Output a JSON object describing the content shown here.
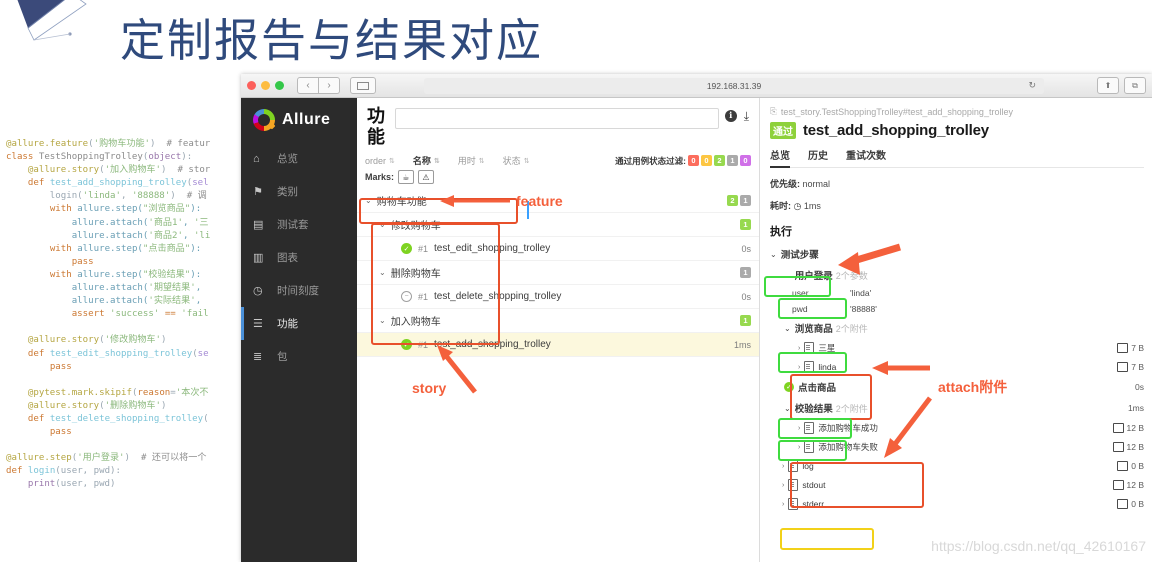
{
  "slide": {
    "title": "定制报告与结果对应",
    "watermark": "https://blog.csdn.net/qq_42610167"
  },
  "code": {
    "lines": [
      "@allure.feature('购物车功能')  # featur",
      "class TestShoppingTrolley(object):",
      "    @allure.story('加入购物车')  # stor",
      "    def test_add_shopping_trolley(sel",
      "        login('linda', '88888')  # 调",
      "        with allure.step(\"浏览商品\"):",
      "            allure.attach('商品1', '三",
      "            allure.attach('商品2', 'li",
      "        with allure.step(\"点击商品\"):",
      "            pass",
      "        with allure.step(\"校验结果\"):",
      "            allure.attach('期望结果',",
      "            allure.attach('实际结果',",
      "            assert 'success' == 'fail",
      "",
      "    @allure.story('修改购物车')",
      "    def test_edit_shopping_trolley(se",
      "        pass",
      "",
      "    @pytest.mark.skipif(reason='本次不",
      "    @allure.story('删除购物车')",
      "    def test_delete_shopping_trolley(",
      "        pass",
      "",
      "@allure.step('用户登录')  # 还可以将一个",
      "def login(user, pwd):",
      "    print(user, pwd)"
    ]
  },
  "browser": {
    "url": "192.168.31.39",
    "back_icon": "‹",
    "forward_icon": "›",
    "reload_icon": "↻",
    "share_icon": "⬆",
    "tabs_icon": "⧉"
  },
  "allure": {
    "brand": "Allure",
    "sidebar": [
      {
        "label": "总览",
        "icon": "home-icon",
        "glyph": "⌂",
        "selected": false
      },
      {
        "label": "类别",
        "icon": "flag-icon",
        "glyph": "⚑",
        "selected": false
      },
      {
        "label": "测试套",
        "icon": "briefcase-icon",
        "glyph": "▤",
        "selected": false
      },
      {
        "label": "图表",
        "icon": "chart-icon",
        "glyph": "▥",
        "selected": false
      },
      {
        "label": "时间刻度",
        "icon": "clock-icon",
        "glyph": "◷",
        "selected": false
      },
      {
        "label": "功能",
        "icon": "list-icon",
        "glyph": "☰",
        "selected": true
      },
      {
        "label": "包",
        "icon": "lines-icon",
        "glyph": "≣",
        "selected": false
      }
    ]
  },
  "main": {
    "title": "功能",
    "search_placeholder": "",
    "search_value": "",
    "columns": [
      {
        "label": "order",
        "bold": false
      },
      {
        "label": "名称",
        "bold": true
      },
      {
        "label": "用时",
        "bold": false
      },
      {
        "label": "状态",
        "bold": false
      }
    ],
    "filter_label": "通过用例状态过滤:",
    "filter_badges": [
      {
        "count": "0",
        "color": "#fc6d5d"
      },
      {
        "count": "0",
        "color": "#fdc642"
      },
      {
        "count": "2",
        "color": "#97d94f"
      },
      {
        "count": "1",
        "color": "#aaaaaa"
      },
      {
        "count": "0",
        "color": "#d070e8"
      }
    ],
    "marks_label": "Marks:",
    "marks": [
      "☕",
      "⚠"
    ],
    "tree": [
      {
        "level": 1,
        "chevron": "⌄",
        "name": "购物车功能",
        "badges": [
          {
            "count": "2",
            "color": "#97d94f"
          },
          {
            "count": "1",
            "color": "#aaaaaa"
          }
        ],
        "time": "",
        "status": "",
        "id": "",
        "selected": false,
        "highlight": "feature-box"
      },
      {
        "level": 2,
        "chevron": "⌄",
        "name": "修改购物车",
        "badges": [
          {
            "count": "1",
            "color": "#97d94f"
          }
        ],
        "time": "",
        "status": "",
        "id": "",
        "selected": false
      },
      {
        "level": 3,
        "chevron": "",
        "name": "test_edit_shopping_trolley",
        "badges": [],
        "time": "0s",
        "status": "pass",
        "id": "#1",
        "selected": false
      },
      {
        "level": 2,
        "chevron": "⌄",
        "name": "删除购物车",
        "badges": [
          {
            "count": "1",
            "color": "#aaaaaa"
          }
        ],
        "time": "",
        "status": "",
        "id": "",
        "selected": false
      },
      {
        "level": 3,
        "chevron": "",
        "name": "test_delete_shopping_trolley",
        "badges": [],
        "time": "0s",
        "status": "skip",
        "id": "#1",
        "selected": false
      },
      {
        "level": 2,
        "chevron": "⌄",
        "name": "加入购物车",
        "badges": [
          {
            "count": "1",
            "color": "#97d94f"
          }
        ],
        "time": "",
        "status": "",
        "id": "",
        "selected": false
      },
      {
        "level": 3,
        "chevron": "",
        "name": "test_add_shopping_trolley",
        "badges": [],
        "time": "1ms",
        "status": "pass",
        "id": "#1",
        "selected": true
      }
    ]
  },
  "detail": {
    "breadcrumb": "test_story.TestShoppingTrolley#test_add_shopping_trolley",
    "status_tag": "通过",
    "test_name": "test_add_shopping_trolley",
    "tabs": [
      {
        "label": "总览",
        "active": true
      },
      {
        "label": "历史",
        "active": false
      },
      {
        "label": "重试次数",
        "active": false
      }
    ],
    "severity_key": "优先级:",
    "severity_val": "normal",
    "duration_key": "耗时:",
    "duration_val": "1ms",
    "execution_header": "执行",
    "steps_label": "测试步骤",
    "nodes": [
      {
        "type": "step",
        "indent": 1,
        "chevron": "⌄",
        "name": "用户登录",
        "sub": "2个参数",
        "size": "",
        "highlight": "green"
      },
      {
        "type": "param",
        "key": "user",
        "value": "'linda'"
      },
      {
        "type": "param",
        "key": "pwd",
        "value": "'88888'"
      },
      {
        "type": "step",
        "indent": 1,
        "chevron": "⌄",
        "name": "浏览商品",
        "sub": "2个附件",
        "size": "",
        "highlight": "green"
      },
      {
        "type": "attach",
        "name": "三星",
        "size": "7 B"
      },
      {
        "type": "attach",
        "name": "linda",
        "size": "7 B"
      },
      {
        "type": "step",
        "indent": 1,
        "chevron": "",
        "name": "点击商品",
        "sub": "",
        "size": "0s",
        "highlight": "green",
        "check": true
      },
      {
        "type": "step",
        "indent": 1,
        "chevron": "⌄",
        "name": "校验结果",
        "sub": "2个附件",
        "size": "1ms",
        "highlight": "green"
      },
      {
        "type": "attach",
        "name": "添加购物车成功",
        "size": "12 B"
      },
      {
        "type": "attach",
        "name": "添加购物车失败",
        "size": "12 B"
      },
      {
        "type": "attach",
        "name": "log",
        "size": "0 B",
        "indent0": true
      },
      {
        "type": "attach",
        "name": "stdout",
        "size": "12 B",
        "indent0": true,
        "highlight": "yellow"
      },
      {
        "type": "attach",
        "name": "stderr",
        "size": "0 B",
        "indent0": true
      }
    ]
  },
  "annotations": [
    {
      "id": "feature",
      "text": "feature"
    },
    {
      "id": "story",
      "text": "story"
    },
    {
      "id": "attach",
      "text": "attach附件"
    }
  ]
}
